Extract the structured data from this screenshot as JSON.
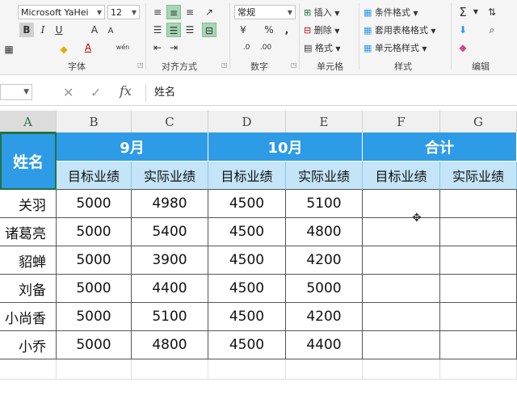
{
  "ribbon": {
    "font_name": "Microsoft YaHei",
    "font_size": "12",
    "number_format": "常规",
    "groups": {
      "font": "字体",
      "alignment": "对齐方式",
      "number": "数字",
      "cells": "单元格",
      "styles": "样式",
      "editing": "编辑"
    },
    "cells_buttons": {
      "insert": "插入",
      "delete": "删除",
      "format": "格式"
    },
    "styles_buttons": {
      "conditional": "条件格式",
      "table": "套用表格格式",
      "cell_styles": "单元格样式"
    },
    "font_buttons": {
      "bold": "B",
      "italic": "I",
      "underline": "U",
      "grow": "A",
      "shrink": "A",
      "font_color": "A",
      "phonetic": "wén"
    },
    "number_buttons": {
      "percent": "%",
      "comma": ","
    },
    "editing_buttons": {
      "sum": "Σ"
    }
  },
  "formula_bar": {
    "fx": "fx",
    "content": "姓名"
  },
  "columns": [
    "A",
    "B",
    "C",
    "D",
    "E",
    "F",
    "G"
  ],
  "sheet": {
    "name_header": "姓名",
    "months": [
      "9月",
      "10月",
      "合计"
    ],
    "sub_headers": [
      "目标业绩",
      "实际业绩",
      "目标业绩",
      "实际业绩",
      "目标业绩",
      "实际业绩"
    ],
    "rows": [
      {
        "name": "关羽",
        "values": [
          "5000",
          "4980",
          "4500",
          "5100"
        ]
      },
      {
        "name": "诸葛亮",
        "values": [
          "5000",
          "5400",
          "4500",
          "4800"
        ]
      },
      {
        "name": "貂蝉",
        "values": [
          "5000",
          "3900",
          "4500",
          "4200"
        ]
      },
      {
        "name": "刘备",
        "values": [
          "5000",
          "4400",
          "4500",
          "5000"
        ]
      },
      {
        "name": "小尚香",
        "values": [
          "5000",
          "5100",
          "4500",
          "4200"
        ]
      },
      {
        "name": "小乔",
        "values": [
          "5000",
          "4800",
          "4500",
          "4400"
        ]
      }
    ]
  },
  "colors": {
    "header_blue": "#2e9be6",
    "sub_header": "#c4e4f7",
    "excel_green": "#217346"
  }
}
